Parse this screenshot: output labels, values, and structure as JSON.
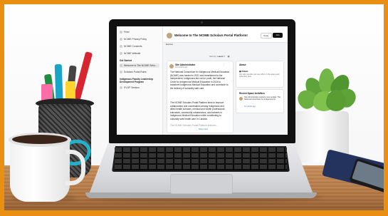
{
  "screen": {
    "sidebar": {
      "items_top": [
        {
          "label": "Feed"
        },
        {
          "label": "NCIME Privacy Policy"
        },
        {
          "label": "NCIME Consents"
        },
        {
          "label": "NCIME Website"
        }
      ],
      "section_get_started": "Get Started",
      "items_get_started": [
        {
          "label": "Welcome to The NCIME Scho...",
          "active": true
        },
        {
          "label": "Scholars Portal Rules"
        }
      ],
      "section_program": "Indigenous Faculty Leadership Development Program",
      "items_program": [
        {
          "label": "IFLDP Session"
        }
      ]
    },
    "header": {
      "title": "Welcome to The NCIME Scholars Portal Platform!",
      "tab_explore": "Explore",
      "reply_label": "Reply",
      "join_label": "Join"
    },
    "sort": {
      "label": "Sort by:",
      "value": "Latest"
    },
    "post": {
      "author": "Site Administrator",
      "time": "10 months ago",
      "paragraph1": "The National Consortium for Indigenous Medical Education (NCIME) was funded in 2021 and transitioned to the independent, Indigenous-led not for profit, the National Circle for Indigenous Medical Education in 2024 to transform Indigenous Medical Education and contribute to the delivery of culturally safe care.",
      "paragraph2": "The NCIME Scholars Portal Platform aims to improve collaboration and coordination among Indigenous and allied health scholars, medical and health professional educators, community collaborators, and trainees in Indigenous Medical Education while contributing to culturally safe health care in Canada.",
      "paragraph3": "The NCIME Scholars Portal Platform features...",
      "show_more": "Show more"
    },
    "about": {
      "heading": "About",
      "visibility": "Public",
      "description": "Any site member can see who's in the space and what they post."
    },
    "recent": {
      "heading": "Recent Space Activities",
      "text": "Site Administrator posted a new update: The National Consortium for Indigenous M...",
      "time": "10 months ago"
    }
  },
  "colors": {
    "frame": "#e98f12",
    "desk": "#b57944",
    "join_button": "#111111",
    "link": "#3b6fb6"
  }
}
